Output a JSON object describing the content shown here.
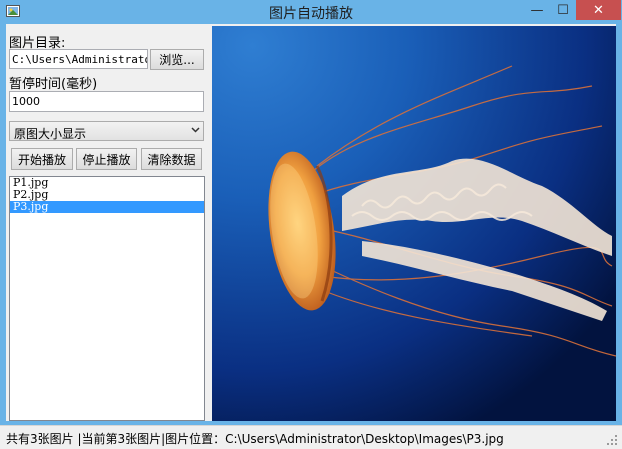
{
  "window": {
    "title": "图片自动播放",
    "min_glyph": "—",
    "max_glyph": "☐",
    "close_glyph": "✕"
  },
  "form": {
    "dir_label": "图片目录:",
    "dir_value": "C:\\Users\\Administrator",
    "browse_label": "浏览...",
    "pause_label": "暂停时间(毫秒)",
    "pause_value": "1000",
    "display_mode": "原图大小显示",
    "start_label": "开始播放",
    "stop_label": "停止播放",
    "clear_label": "清除数据"
  },
  "files": [
    "P1.jpg",
    "P2.jpg",
    "P3.jpg"
  ],
  "selected_index": 2,
  "status": {
    "text": "共有3张图片  |当前第3张图片|图片位置：C:\\Users\\Administrator\\Desktop\\Images\\P3.jpg"
  },
  "image": {
    "subject": "jellyfish photo",
    "colors": {
      "sea_dark": "#02133f",
      "sea_light": "#1a5fb8",
      "jelly": "#f0a040"
    }
  }
}
